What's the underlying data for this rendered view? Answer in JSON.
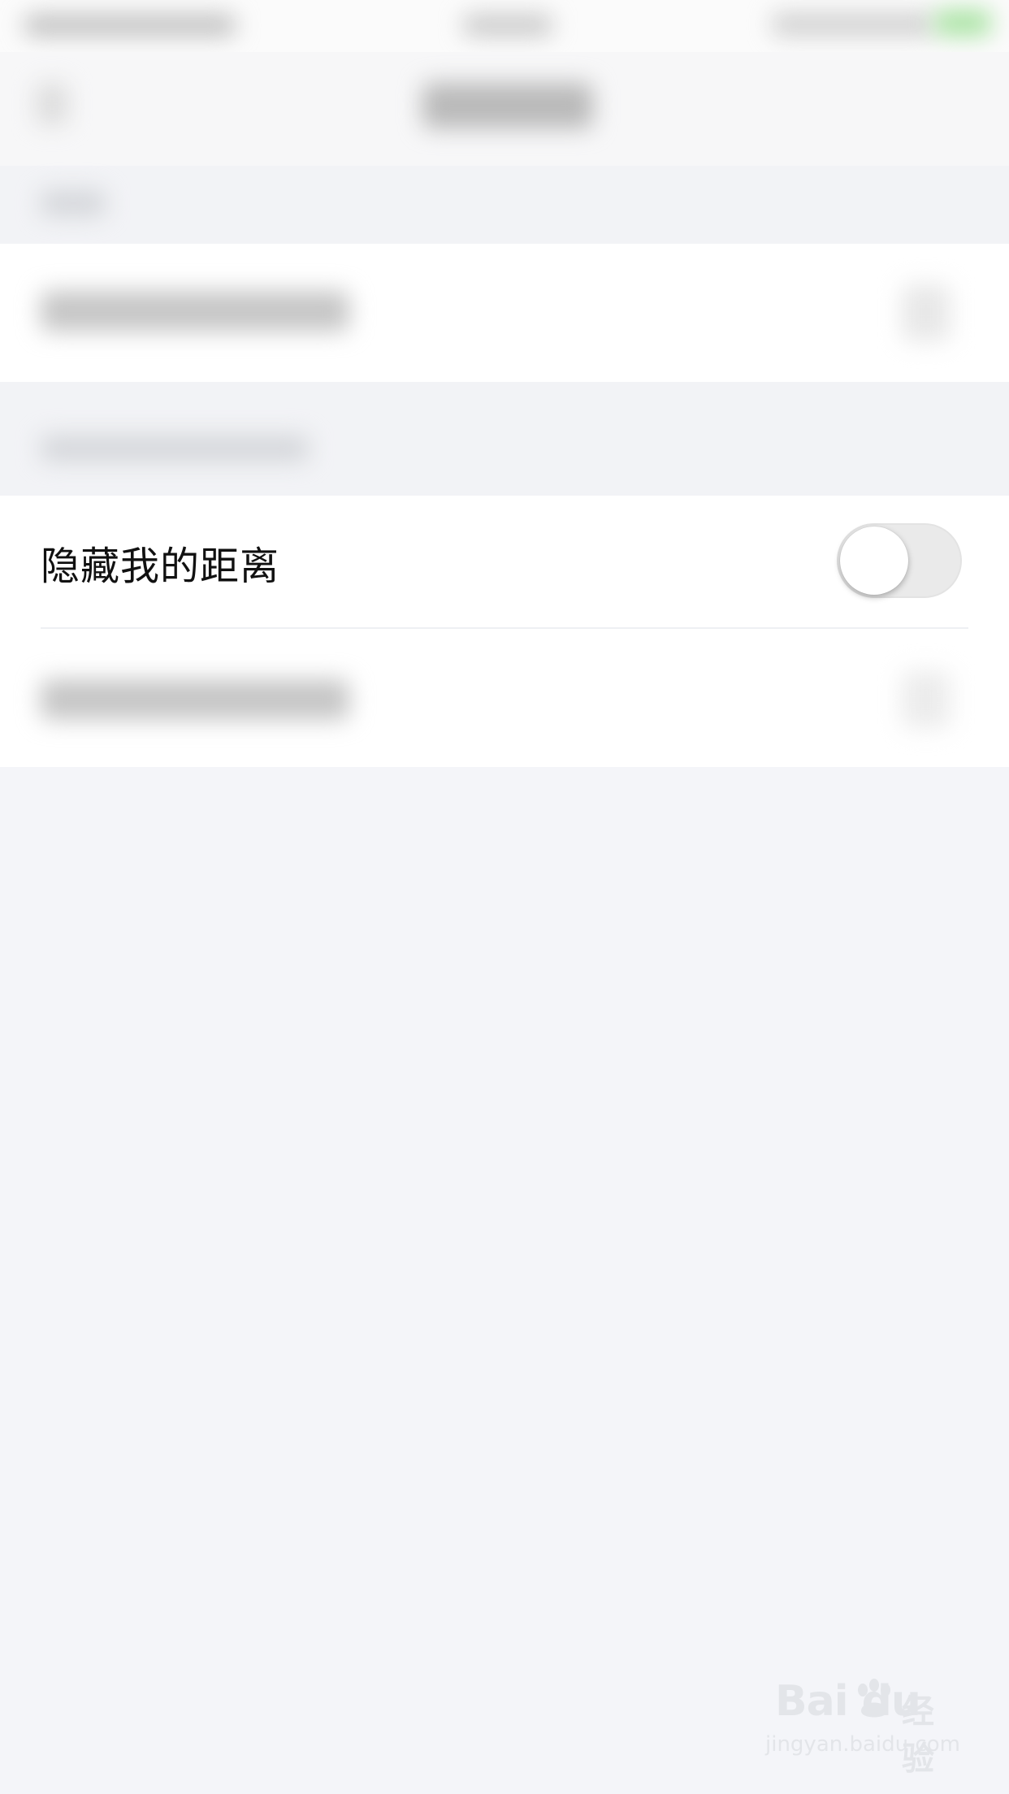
{
  "settings": {
    "hide_distance_label": "隐藏我的距离",
    "hide_distance_enabled": false
  },
  "watermark": {
    "brand": "Bai du",
    "brand_cn": "经验",
    "url": "jingyan.baidu.com"
  },
  "colors": {
    "background": "#f4f5f9",
    "row_background": "#ffffff",
    "toggle_off": "#eaeaea",
    "status_green": "#4cd964"
  }
}
